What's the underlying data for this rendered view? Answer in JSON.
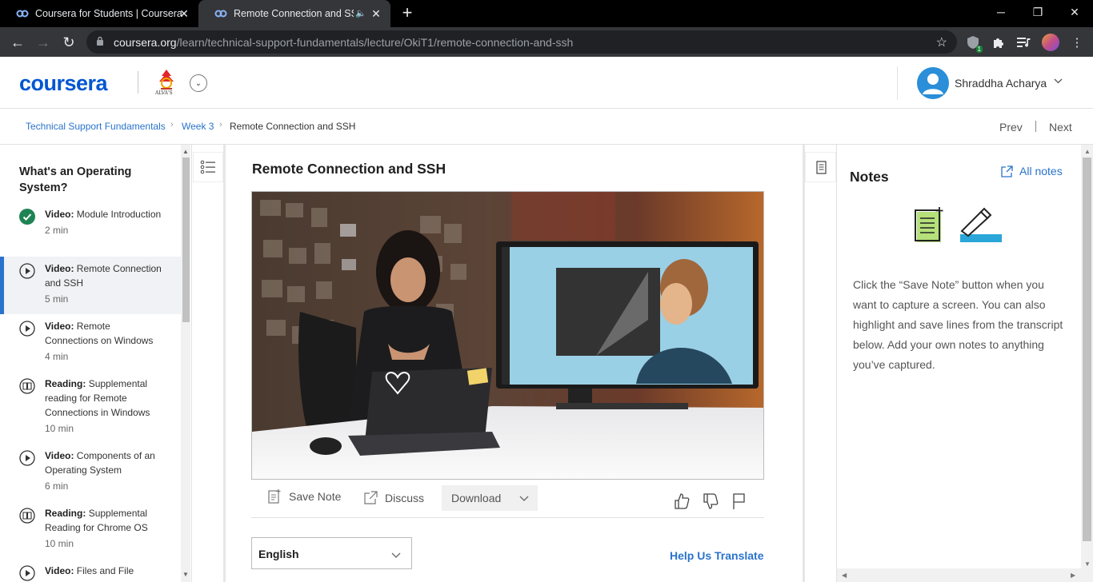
{
  "browser": {
    "tabs": [
      {
        "title": "Coursera for Students | Coursera",
        "favicon": "coursera-icon"
      },
      {
        "title": "Remote Connection and SSH",
        "favicon": "coursera-icon",
        "audio": true
      }
    ],
    "url_host": "coursera.org",
    "url_path": "/learn/technical-support-fundamentals/lecture/OkiT1/remote-connection-and-ssh",
    "extension_badge": "1"
  },
  "header": {
    "logo": "coursera",
    "partner_logo_text": "ALVA'S",
    "user_name": "Shraddha Acharya"
  },
  "breadcrumb": {
    "course": "Technical Support Fundamentals",
    "week": "Week 3",
    "current": "Remote Connection and SSH",
    "prev": "Prev",
    "next": "Next"
  },
  "sidebar": {
    "section_title": "What's an Operating System?",
    "items": [
      {
        "kind": "Video:",
        "title": "Module Introduction",
        "duration": "2 min",
        "status": "completed"
      },
      {
        "kind": "Video:",
        "title": "Remote Connection and SSH",
        "duration": "5 min",
        "status": "active"
      },
      {
        "kind": "Video:",
        "title": "Remote Connections on Windows",
        "duration": "4 min",
        "status": "video"
      },
      {
        "kind": "Reading:",
        "title": "Supplemental reading for Remote Connections in Windows",
        "duration": "10 min",
        "status": "reading"
      },
      {
        "kind": "Video:",
        "title": "Components of an Operating System",
        "duration": "6 min",
        "status": "video"
      },
      {
        "kind": "Reading:",
        "title": "Supplemental Reading for Chrome OS",
        "duration": "10 min",
        "status": "reading"
      },
      {
        "kind": "Video:",
        "title": "Files and File",
        "duration": "",
        "status": "video"
      }
    ]
  },
  "main": {
    "lecture_title": "Remote Connection and SSH",
    "actions": {
      "save_note": "Save Note",
      "discuss": "Discuss",
      "download": "Download"
    },
    "language": "English",
    "help_translate": "Help Us Translate"
  },
  "notes": {
    "title": "Notes",
    "all_notes": "All notes",
    "body": "Click the “Save Note” button when you want to capture a screen. You can also highlight and save lines from the transcript below. Add your own notes to anything you’ve captured."
  },
  "colors": {
    "brand": "#0056d2",
    "link": "#2a73cc",
    "completed": "#1f8354",
    "active_bar": "#2a73cc"
  }
}
